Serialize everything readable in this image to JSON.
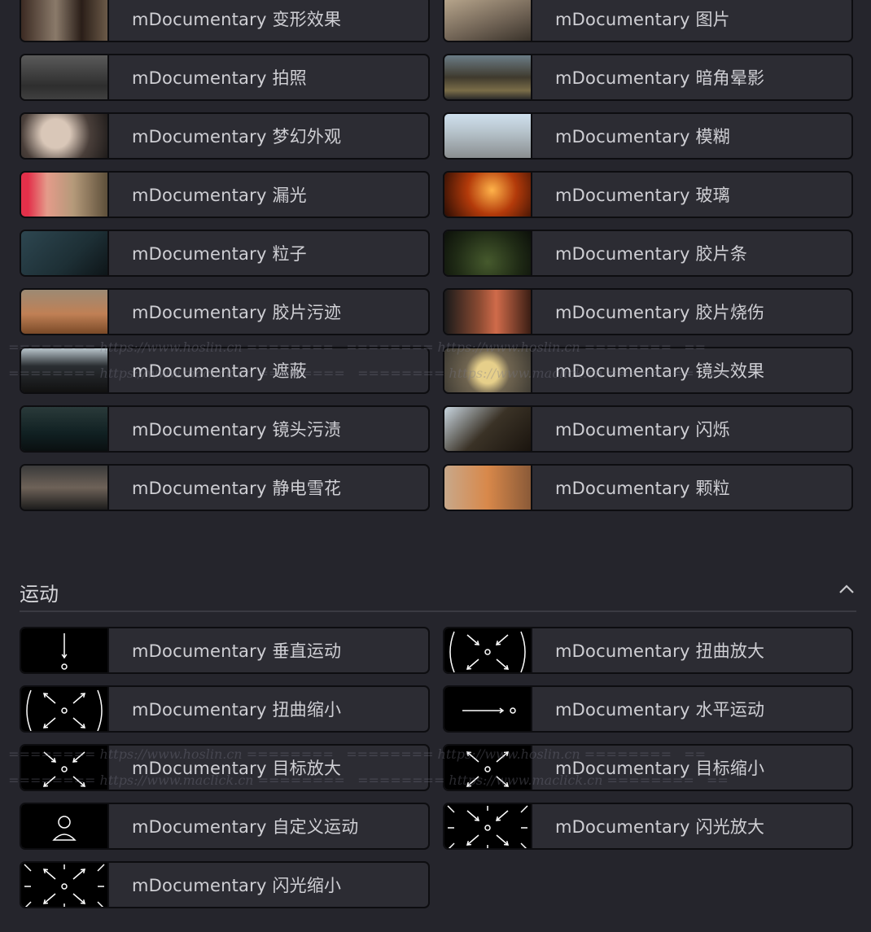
{
  "effects": [
    {
      "label": "mDocumentary 变形效果",
      "thumb": "t1"
    },
    {
      "label": "mDocumentary 图片",
      "thumb": "t2"
    },
    {
      "label": "mDocumentary 拍照",
      "thumb": "t3"
    },
    {
      "label": "mDocumentary 暗角晕影",
      "thumb": "t4"
    },
    {
      "label": "mDocumentary 梦幻外观",
      "thumb": "t5"
    },
    {
      "label": "mDocumentary 模糊",
      "thumb": "t6"
    },
    {
      "label": "mDocumentary 漏光",
      "thumb": "t7"
    },
    {
      "label": "mDocumentary 玻璃",
      "thumb": "t8"
    },
    {
      "label": "mDocumentary 粒子",
      "thumb": "t9"
    },
    {
      "label": "mDocumentary 胶片条",
      "thumb": "t10"
    },
    {
      "label": "mDocumentary 胶片污迹",
      "thumb": "t11"
    },
    {
      "label": "mDocumentary 胶片烧伤",
      "thumb": "t12"
    },
    {
      "label": "mDocumentary 遮蔽",
      "thumb": "t13"
    },
    {
      "label": "mDocumentary 镜头效果",
      "thumb": "t14"
    },
    {
      "label": "mDocumentary 镜头污渍",
      "thumb": "t15"
    },
    {
      "label": "mDocumentary 闪烁",
      "thumb": "t16"
    },
    {
      "label": "mDocumentary 静电雪花",
      "thumb": "t17"
    },
    {
      "label": "mDocumentary 颗粒",
      "thumb": "t18"
    }
  ],
  "motion_section": {
    "title": "运动",
    "collapse_icon": "chevron-up-icon"
  },
  "motion": [
    {
      "label": "mDocumentary 垂直运动",
      "icon": "vertical-arrow-icon"
    },
    {
      "label": "mDocumentary 扭曲放大",
      "icon": "warp-in-icon"
    },
    {
      "label": "mDocumentary 扭曲缩小",
      "icon": "warp-out-icon"
    },
    {
      "label": "mDocumentary 水平运动",
      "icon": "horizontal-arrow-icon"
    },
    {
      "label": "mDocumentary 目标放大",
      "icon": "target-in-icon"
    },
    {
      "label": "mDocumentary 目标缩小",
      "icon": "target-out-icon"
    },
    {
      "label": "mDocumentary 自定义运动",
      "icon": "person-icon"
    },
    {
      "label": "mDocumentary 闪光放大",
      "icon": "flash-in-icon"
    },
    {
      "label": "mDocumentary 闪光缩小",
      "icon": "flash-out-icon"
    }
  ],
  "watermark": {
    "line1": "======== https://www.hoslin.cn ========",
    "line2": "======== https://www.maclick.cn ========"
  }
}
